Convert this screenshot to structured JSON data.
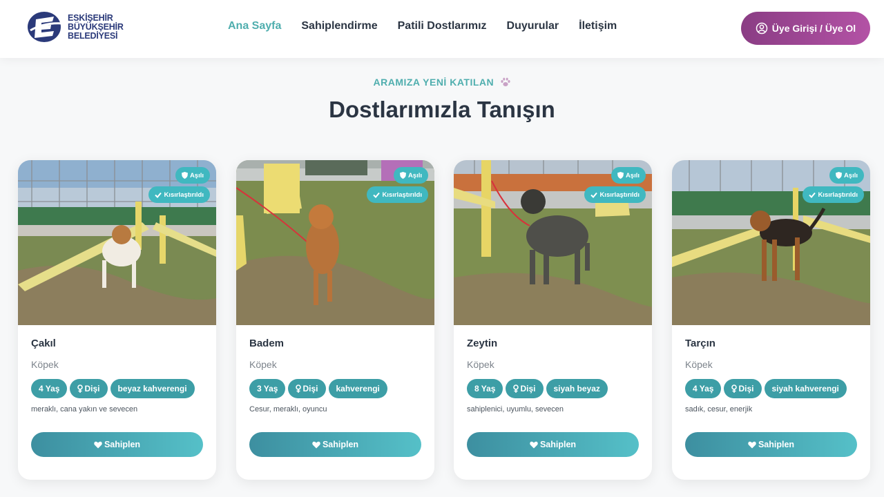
{
  "header": {
    "logo_lines": [
      "ESKİŞEHİR",
      "BÜYÜKŞEHİR",
      "BELEDİYESİ"
    ],
    "nav": [
      {
        "label": "Ana Sayfa",
        "active": true
      },
      {
        "label": "Sahiplendirme",
        "active": false
      },
      {
        "label": "Patili Dostlarımız",
        "active": false
      },
      {
        "label": "Duyurular",
        "active": false
      },
      {
        "label": "İletişim",
        "active": false
      }
    ],
    "login_label": "Üye Girişi / Üye Ol",
    "accent": "#4faeae",
    "login_color": "#9a4592"
  },
  "section": {
    "subtitle": "ARAMIZA YENİ KATILAN",
    "title": "Dostlarımızla Tanışın"
  },
  "cards": [
    {
      "name": "Çakıl",
      "species": "Köpek",
      "badges": {
        "vaccinated": "Aşılı",
        "neutered": "Kısırlaştırıldı"
      },
      "age": "4 Yaş",
      "sex": "Dişi",
      "color": "beyaz kahverengi",
      "description": "meraklı, cana yakın ve sevecen",
      "adopt_label": "Sahiplen"
    },
    {
      "name": "Badem",
      "species": "Köpek",
      "badges": {
        "vaccinated": "Aşılı",
        "neutered": "Kısırlaştırıldı"
      },
      "age": "3 Yaş",
      "sex": "Dişi",
      "color": "kahverengi",
      "description": "Cesur, meraklı, oyuncu",
      "adopt_label": "Sahiplen"
    },
    {
      "name": "Zeytin",
      "species": "Köpek",
      "badges": {
        "vaccinated": "Aşılı",
        "neutered": "Kısırlaştırıldı"
      },
      "age": "8 Yaş",
      "sex": "Dişi",
      "color": "siyah beyaz",
      "description": "sahiplenici, uyumlu, sevecen",
      "adopt_label": "Sahiplen"
    },
    {
      "name": "Tarçın",
      "species": "Köpek",
      "badges": {
        "vaccinated": "Aşılı",
        "neutered": "Kısırlaştırıldı"
      },
      "age": "4 Yaş",
      "sex": "Dişi",
      "color": "siyah kahverengi",
      "description": "sadık, cesur, enerjik",
      "adopt_label": "Sahiplen"
    }
  ]
}
